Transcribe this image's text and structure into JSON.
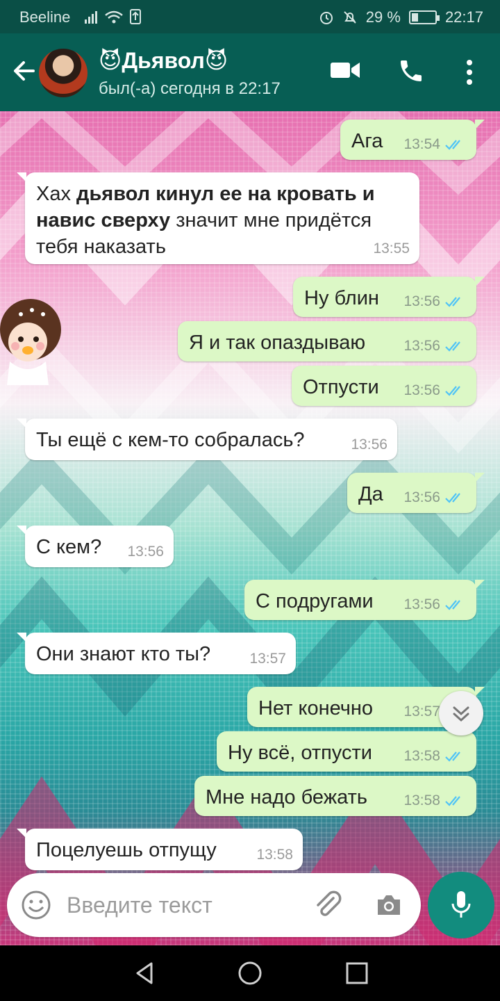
{
  "status_bar": {
    "carrier": "Beeline",
    "battery": "29 %",
    "battery_level": 0.29,
    "time": "22:17"
  },
  "header": {
    "name": "😈Дьявол😈",
    "status": "был(-а) сегодня в 22:17",
    "icons": [
      "back-arrow-icon",
      "avatar",
      "video-call-icon",
      "phone-icon",
      "more-vert-icon"
    ]
  },
  "messages": [
    {
      "dir": "out",
      "text": "Ага",
      "time": "13:54",
      "read": true
    },
    {
      "dir": "in",
      "parts": [
        {
          "t": "Хах ",
          "b": false
        },
        {
          "t": "дьявол кинул ее на кровать и навис сверху",
          "b": true
        },
        {
          "t": " значит мне придётся тебя наказать",
          "b": false
        }
      ],
      "time": "13:55"
    },
    {
      "dir": "out",
      "text": "Ну блин",
      "time": "13:56",
      "read": true
    },
    {
      "dir": "out",
      "text": "Я и так опаздываю",
      "time": "13:56",
      "read": true
    },
    {
      "dir": "out",
      "text": "Отпусти",
      "time": "13:56",
      "read": true
    },
    {
      "dir": "in",
      "text": "Ты ещё с кем-то собралась?",
      "time": "13:56"
    },
    {
      "dir": "out",
      "text": "Да",
      "time": "13:56",
      "read": true
    },
    {
      "dir": "in",
      "text": "С кем?",
      "time": "13:56"
    },
    {
      "dir": "out",
      "text": "С подругами",
      "time": "13:56",
      "read": true
    },
    {
      "dir": "in",
      "text": "Они знают кто ты?",
      "time": "13:57"
    },
    {
      "dir": "out",
      "text": "Нет конечно",
      "time": "13:57",
      "read": true
    },
    {
      "dir": "out",
      "text": "Ну всё, отпусти",
      "time": "13:58",
      "read": true
    },
    {
      "dir": "out",
      "text": "Мне надо бежать",
      "time": "13:58",
      "read": true
    },
    {
      "dir": "in",
      "text": "Поцелуешь отпущу",
      "time": "13:58"
    }
  ],
  "input": {
    "placeholder": "Введите текст",
    "icons": [
      "emoji-icon",
      "attach-icon",
      "camera-icon",
      "mic-icon"
    ]
  },
  "nav": {
    "icons": [
      "nav-back-icon",
      "nav-home-icon",
      "nav-recents-icon"
    ]
  },
  "colors": {
    "header": "#075e54",
    "outgoing_bubble": "#dcf8c6",
    "incoming_bubble": "#ffffff",
    "read_ticks": "#4fc3f7",
    "mic_button": "#128c7e"
  }
}
